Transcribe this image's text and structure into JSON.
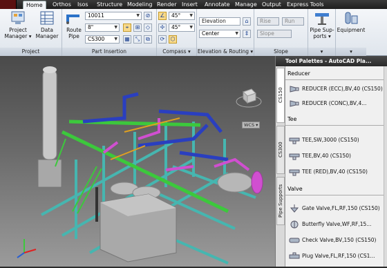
{
  "tabs": [
    "Home",
    "Orthos",
    "Isos",
    "Structure",
    "Modeling",
    "Render",
    "Insert",
    "Annotate",
    "Manage",
    "Output",
    "Express Tools"
  ],
  "active_tab": "Home",
  "ribbon": {
    "project": {
      "title": "Project",
      "manager_label_1": "Project",
      "manager_label_2": "Manager",
      "data_label_1": "Data",
      "data_label_2": "Manager"
    },
    "part_insertion": {
      "title": "Part Insertion",
      "route_1": "Route",
      "route_2": "Pipe",
      "spec_value": "10011",
      "size_value": "8\"",
      "class_value": "CS300"
    },
    "compass": {
      "title": "Compass",
      "angle_1": "45°",
      "angle_2": "45°"
    },
    "elevation": {
      "title": "Elevation & Routing",
      "elevation_value": "Elevation",
      "center_value": "Center"
    },
    "slope": {
      "title": "Slope",
      "rise": "Rise",
      "run": "Run",
      "slope": "Slope"
    },
    "pipe_supports": {
      "label_1": "Pipe Sup-",
      "label_2": "ports"
    },
    "equipment": {
      "label": "Equipment"
    }
  },
  "viewport": {
    "compass_text": "WCS"
  },
  "palette": {
    "title": "Tool Palettes - AutoCAD Pla...",
    "vtabs": [
      "CS150",
      "CS300",
      "Pipe Supports"
    ],
    "sections": [
      {
        "name": "Reducer",
        "items": [
          "REDUCER (ECC),BV,40 (CS150)",
          "REDUCER (CONC),BV,4..."
        ]
      },
      {
        "name": "Tee",
        "items": [
          "TEE,SW,3000 (CS150)",
          "TEE,BV,40 (CS150)",
          "TEE (RED),BV,40 (CS150)"
        ]
      },
      {
        "name": "Valve",
        "items": [
          "Gate Valve,FL,RF,150 (CS150)",
          "Butterfly Valve,WF,RF,15...",
          "Check Valve,BV,150 (CS150)",
          "Plug Valve,FL,RF,150 (CS1..."
        ]
      }
    ]
  },
  "colors": {
    "pipe_green": "#3cc83c",
    "pipe_blue": "#2a3fbf",
    "pipe_magenta": "#d04fd0",
    "steel_cyan": "#46b6b0",
    "equipment_gray": "#b8b8b8"
  }
}
